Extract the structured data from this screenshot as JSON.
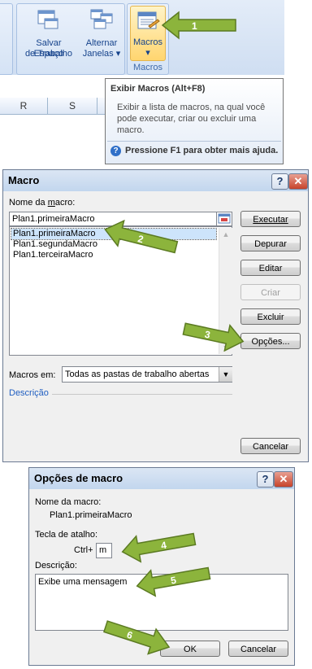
{
  "ribbon": {
    "workspace_label": "Salvar Espaço de Trabalho",
    "workspace_line1": "Salvar Espaço",
    "workspace_line2": "de Trabalho",
    "windows_line1": "Alternar",
    "windows_line2": "Janelas",
    "macros_label": "Macros",
    "macros_group_label": "Macros"
  },
  "sheet": {
    "columns": [
      "R",
      "S"
    ]
  },
  "tooltip": {
    "title": "Exibir Macros (Alt+F8)",
    "body_line1": "Exibir a lista de macros, na qual você",
    "body_line2": "pode executar, criar ou excluir uma",
    "body_line3": "macro.",
    "help": "Pressione F1 para obter mais ajuda."
  },
  "macro_dialog": {
    "title": "Macro",
    "name_label_pre": "Nome da ",
    "name_label_u": "m",
    "name_label_post": "acro:",
    "name_value": "Plan1.primeiraMacro",
    "macros": [
      "Plan1.primeiraMacro",
      "Plan1.segundaMacro",
      "Plan1.terceiraMacro"
    ],
    "buttons": {
      "run": "Executar",
      "debug": "Depurar",
      "edit": "Editar",
      "create": "Criar",
      "delete": "Excluir",
      "options": "Opções...",
      "cancel": "Cancelar"
    },
    "macros_in_label": "Macros em:",
    "macros_in_value": "Todas as pastas de trabalho abertas",
    "description_label": "Descrição"
  },
  "options_dialog": {
    "title": "Opções de macro",
    "name_label": "Nome da macro:",
    "name_value": "Plan1.primeiraMacro",
    "shortcut_label": "Tecla de atalho:",
    "ctrl_label": "Ctrl+",
    "shortcut_value": "m",
    "description_label": "Descrição:",
    "description_value": "Exibe uma mensagem",
    "ok": "OK",
    "cancel": "Cancelar"
  },
  "callouts": [
    "1",
    "2",
    "3",
    "4",
    "5",
    "6"
  ],
  "colors": {
    "arrow_fill": "#8cb43c",
    "arrow_stroke": "#5b7a22",
    "ribbon_accent": "#15428b"
  }
}
